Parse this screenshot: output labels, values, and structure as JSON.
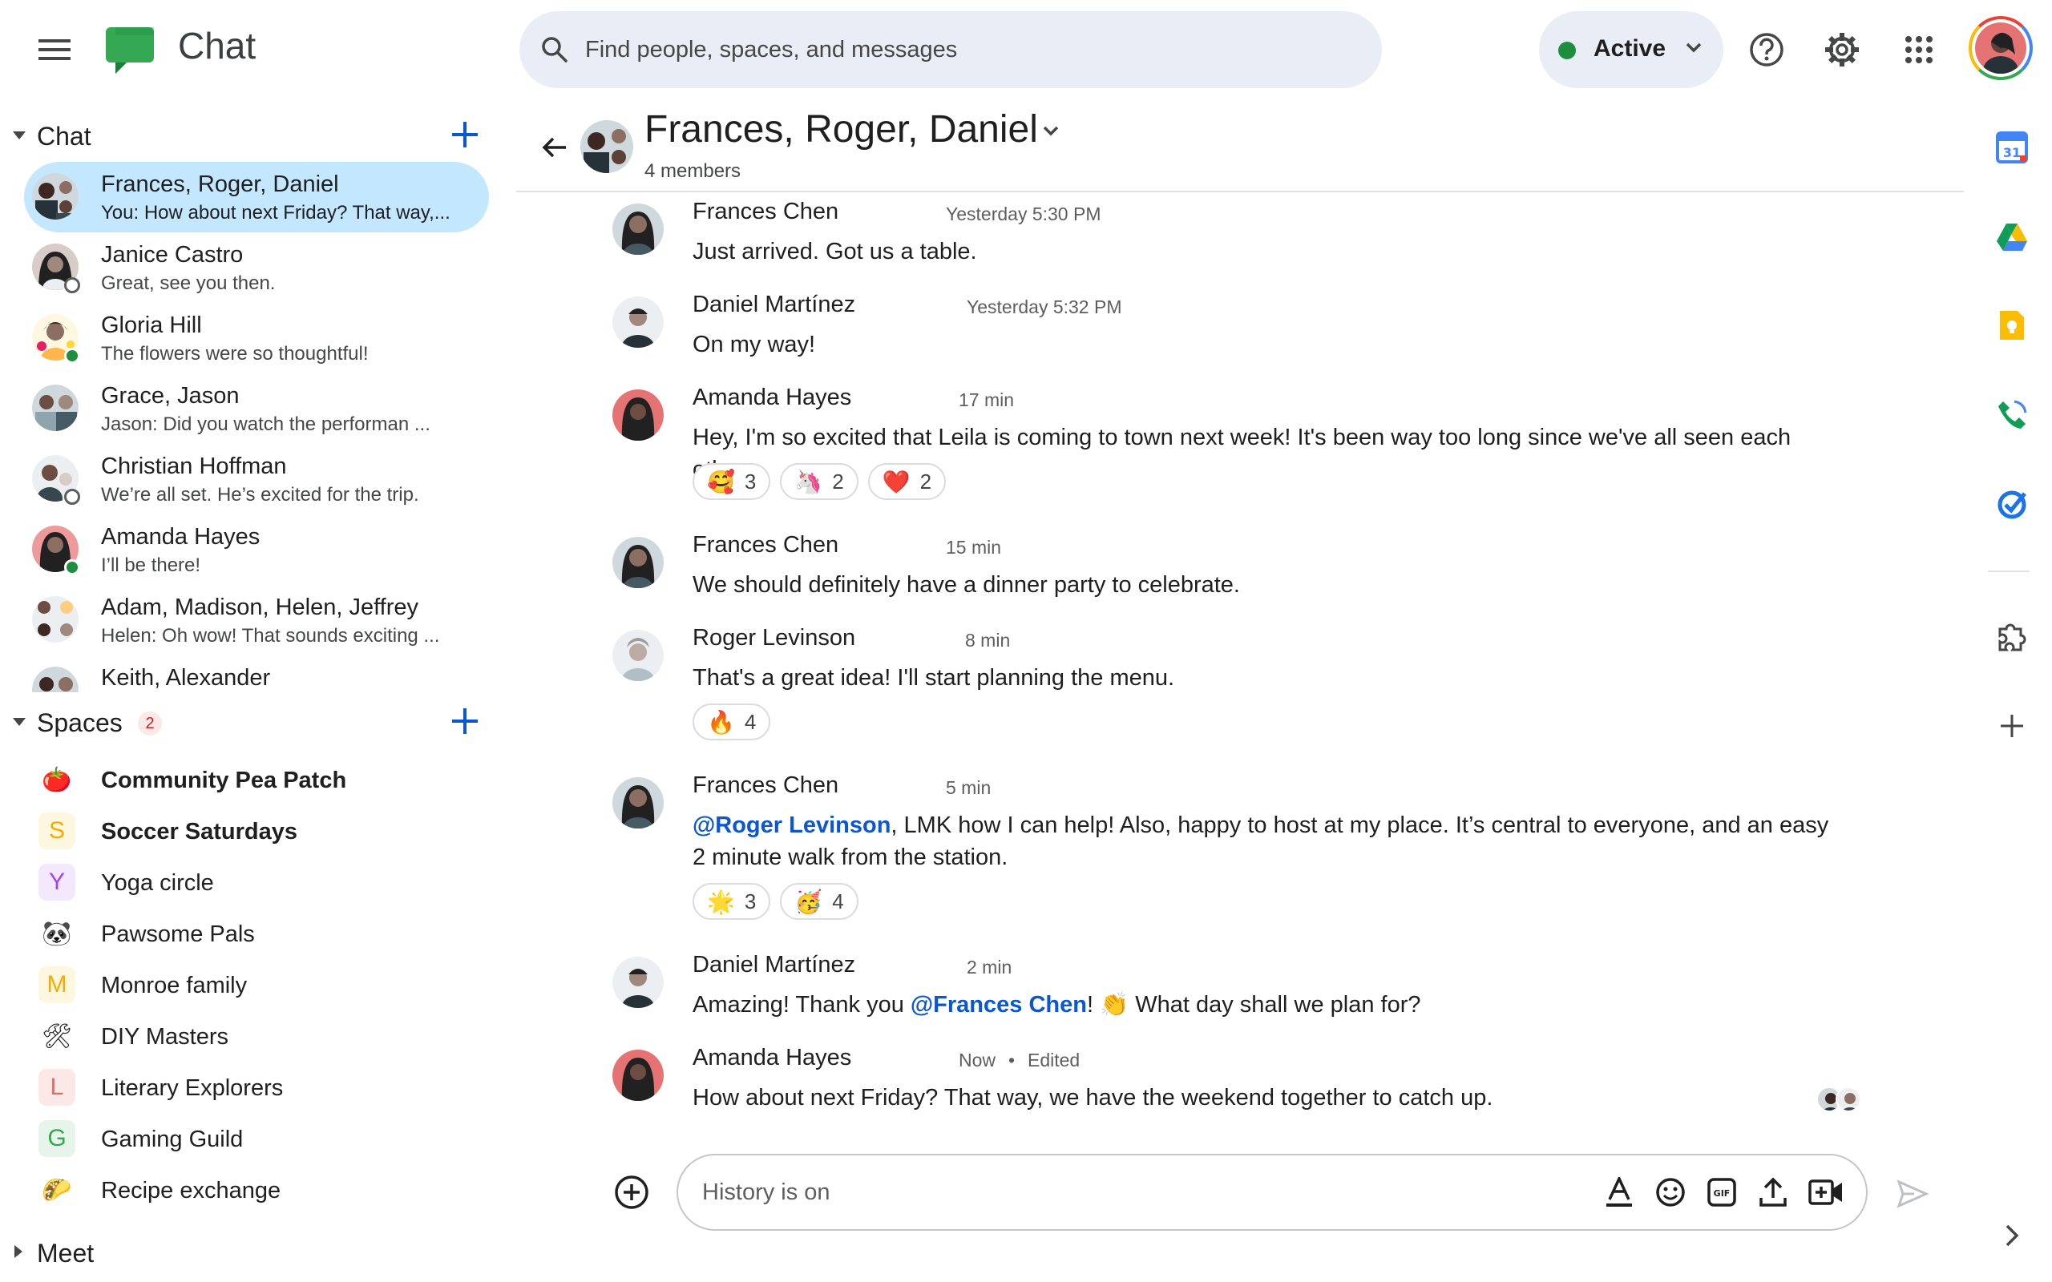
{
  "app": {
    "title": "Chat",
    "accent": "#0b57d0"
  },
  "search": {
    "placeholder": "Find people, spaces, and messages"
  },
  "status": {
    "label": "Active",
    "color": "#1e8e3e"
  },
  "icons": {
    "menu": "menu-icon",
    "search": "search-icon",
    "help": "help-icon",
    "settings": "gear-icon",
    "apps": "apps-grid-icon"
  },
  "sidebar": {
    "chat_section": {
      "title": "Chat"
    },
    "chats": [
      {
        "name": "Frances, Roger, Daniel",
        "preview": "You: How about next Friday? That way,...",
        "selected": true,
        "presence": ""
      },
      {
        "name": "Janice Castro",
        "preview": "Great, see you then.",
        "presence": "away"
      },
      {
        "name": "Gloria Hill",
        "preview": "The flowers were so thoughtful!",
        "presence": "online"
      },
      {
        "name": "Grace, Jason",
        "preview": "Jason: Did you watch the performan ...",
        "presence": ""
      },
      {
        "name": "Christian Hoffman",
        "preview": "We’re all set.  He’s excited for the trip.",
        "presence": "away"
      },
      {
        "name": "Amanda Hayes",
        "preview": "I’ll be there!",
        "presence": "online"
      },
      {
        "name": "Adam, Madison, Helen, Jeffrey",
        "preview": "Helen: Oh wow! That sounds exciting ...",
        "presence": ""
      },
      {
        "name": "Keith, Alexander",
        "preview": "",
        "presence": ""
      }
    ],
    "spaces_section": {
      "title": "Spaces",
      "badge": "2"
    },
    "spaces": [
      {
        "name": "Community Pea Patch",
        "icon": "🍅",
        "bold": true
      },
      {
        "name": "Soccer Saturdays",
        "icon": "S",
        "bold": true
      },
      {
        "name": "Yoga circle",
        "icon": "Y",
        "bold": false
      },
      {
        "name": "Pawsome Pals",
        "icon": "🐼",
        "bold": false
      },
      {
        "name": "Monroe family",
        "icon": "M",
        "bold": false
      },
      {
        "name": "DIY Masters",
        "icon": "🛠",
        "bold": false
      },
      {
        "name": "Literary Explorers",
        "icon": "L",
        "bold": false
      },
      {
        "name": "Gaming Guild",
        "icon": "G",
        "bold": false
      },
      {
        "name": "Recipe exchange",
        "icon": "🌮",
        "bold": false
      }
    ],
    "meet_section": {
      "title": "Meet"
    }
  },
  "conversation": {
    "title": "Frances, Roger, Daniel",
    "members": "4 members",
    "messages": [
      {
        "sender": "Frances Chen",
        "time": "Yesterday 5:30 PM",
        "text": "Just arrived.  Got us a table.",
        "reactions": []
      },
      {
        "sender": "Daniel Martínez",
        "time": "Yesterday 5:32 PM",
        "text": "On my way!",
        "reactions": []
      },
      {
        "sender": "Amanda Hayes",
        "time": "17 min",
        "text": "Hey, I'm so excited that Leila is coming to town next week! It's been way too long since we've all seen each other.",
        "reactions": [
          {
            "emoji": "🥰",
            "count": "3"
          },
          {
            "emoji": "🦄",
            "count": "2"
          },
          {
            "emoji": "❤️",
            "count": "2"
          }
        ]
      },
      {
        "sender": "Frances Chen",
        "time": "15 min",
        "text": "We should definitely have a dinner party to celebrate.",
        "reactions": []
      },
      {
        "sender": "Roger Levinson",
        "time": "8 min",
        "text": "That's a great idea! I'll start planning the menu.",
        "reactions": [
          {
            "emoji": "🔥",
            "count": "4"
          }
        ]
      },
      {
        "sender": "Frances Chen",
        "time": "5 min",
        "mention": "@Roger Levinson",
        "text": ", LMK how I can help!  Also, happy to host at my place. It’s central to everyone, and an easy 2 minute walk from the station.",
        "reactions": [
          {
            "emoji": "🌟",
            "count": "3"
          },
          {
            "emoji": "🥳",
            "count": "4"
          }
        ]
      },
      {
        "sender": "Daniel Martínez",
        "time": "2 min",
        "text_before": "Amazing! Thank you ",
        "mention": "@Frances Chen",
        "text_after": "! 👏 What day shall we plan for?",
        "reactions": []
      },
      {
        "sender": "Amanda Hayes",
        "time": "Now",
        "edited": "Edited",
        "text": "How about next Friday? That way, we have the weekend together to catch up.",
        "reactions": []
      }
    ]
  },
  "composer": {
    "placeholder": "History is on"
  },
  "rail": {
    "apps": [
      "calendar-icon",
      "drive-icon",
      "keep-icon",
      "voice-icon",
      "tasks-icon",
      "addons-icon",
      "add-icon"
    ]
  }
}
